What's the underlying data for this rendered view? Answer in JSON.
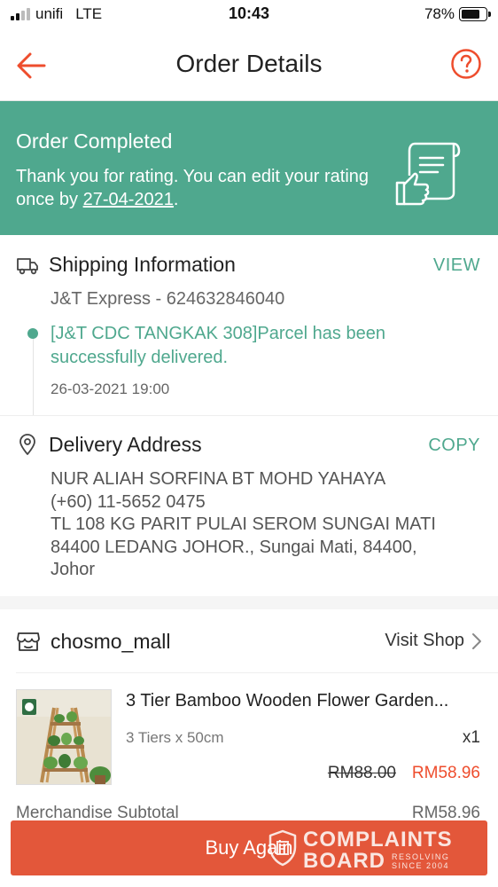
{
  "status_bar": {
    "carrier": "unifi",
    "network": "LTE",
    "time": "10:43",
    "battery": "78%",
    "battery_level": 0.78
  },
  "nav": {
    "title": "Order Details",
    "back_icon": "arrow-left-icon",
    "help_icon": "question-circle-icon"
  },
  "banner": {
    "title": "Order Completed",
    "text_prefix": "Thank you for rating. You can edit your rating once by ",
    "date": "27-04-2021",
    "text_suffix": ".",
    "icon": "rating-receipt-icon",
    "background": "#4fa88e"
  },
  "shipping": {
    "title": "Shipping Information",
    "action": "VIEW",
    "tracking": "J&T Express - 624632846040",
    "status": "[J&T CDC TANGKAK 308]Parcel has been successfully delivered.",
    "timestamp": "26-03-2021 19:00",
    "icon": "truck-icon"
  },
  "address": {
    "title": "Delivery Address",
    "action": "COPY",
    "name": "NUR ALIAH SORFINA BT MOHD YAHAYA",
    "phone": "(+60) 11-5652 0475",
    "line1": "TL 108 KG PARIT PULAI SEROM SUNGAI MATI",
    "line2": "84400 LEDANG JOHOR., Sungai Mati, 84400,",
    "line3": "Johor",
    "icon": "location-pin-icon"
  },
  "shop": {
    "name": "chosmo_mall",
    "visit_label": "Visit Shop",
    "icon": "shop-icon"
  },
  "product": {
    "name": "3 Tier Bamboo Wooden Flower Garden...",
    "variant": "3 Tiers x 50cm",
    "quantity": "x1",
    "original_price": "RM88.00",
    "price": "RM58.96"
  },
  "subtotal": {
    "label": "Merchandise Subtotal",
    "value": "RM58.96"
  },
  "buy_again": {
    "label": "Buy Again",
    "color": "#e3573a"
  },
  "watermark": {
    "line1": "COMPLAINTS",
    "line2": "BOARD",
    "tagline1": "RESOLVING",
    "tagline2": "SINCE 2004"
  }
}
